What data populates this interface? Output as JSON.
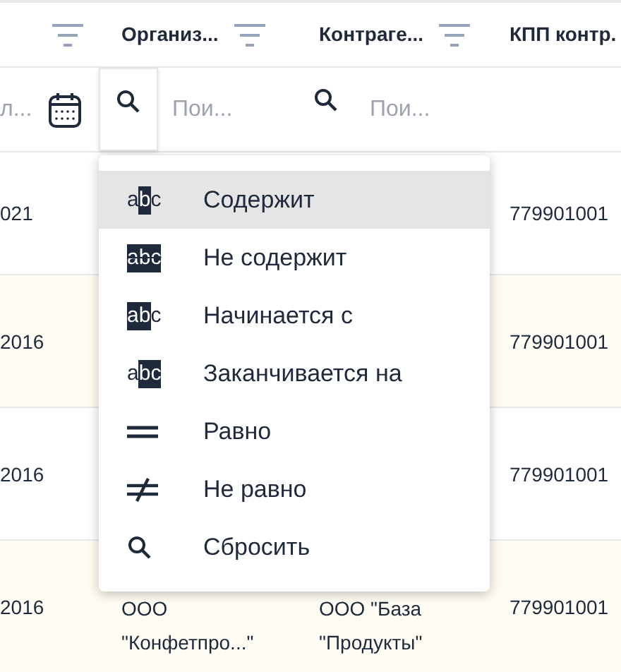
{
  "columns": [
    {
      "label": "Организ..."
    },
    {
      "label": "Контраге..."
    },
    {
      "label": "КПП контр."
    }
  ],
  "filter_row": {
    "date_value": "л...",
    "search_fields": [
      {
        "placeholder": "Пои...",
        "active": true
      },
      {
        "placeholder": "Пои...",
        "active": false
      }
    ]
  },
  "rows": [
    {
      "cells": [
        "021",
        "",
        "",
        "779901001"
      ]
    },
    {
      "cells": [
        "2016",
        "",
        "",
        "779901001"
      ]
    },
    {
      "cells": [
        "2016",
        "",
        "",
        "779901001"
      ]
    },
    {
      "cells": [
        "2016",
        "ООО \"Конфетпро...\"",
        "ООО \"База \"Продукты\"",
        "779901001"
      ]
    }
  ],
  "menu": {
    "items": [
      {
        "kind": "contains",
        "icon_text": "abc",
        "label": "Содержит",
        "selected": true
      },
      {
        "kind": "not_contains",
        "icon_text": "abc",
        "label": "Не содержит",
        "selected": false
      },
      {
        "kind": "starts_with",
        "icon_text": "abc",
        "label": "Начинается с",
        "selected": false
      },
      {
        "kind": "ends_with",
        "icon_text": "abc",
        "label": "Заканчивается на",
        "selected": false
      },
      {
        "kind": "equals",
        "label": "Равно",
        "selected": false
      },
      {
        "kind": "not_equals",
        "label": "Не равно",
        "selected": false
      },
      {
        "kind": "reset",
        "label": "Сбросить",
        "selected": false
      }
    ]
  }
}
